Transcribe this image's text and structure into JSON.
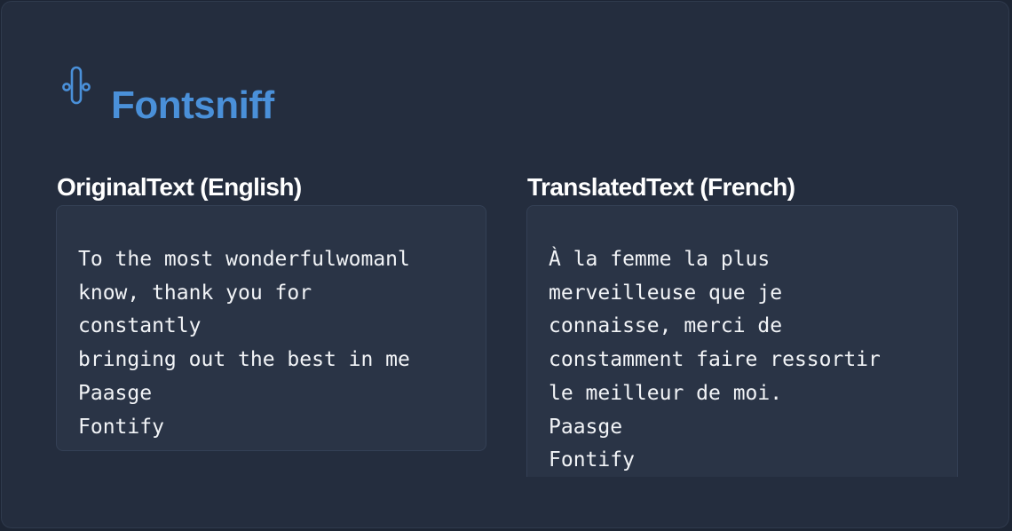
{
  "app": {
    "name": "Fontsniff",
    "logo_icon": "tuning-fork-icon",
    "accent_color": "#4a90d9"
  },
  "original": {
    "title": "OriginalText (English)",
    "text": "To the most wonderfulwomanl\nknow, thank you for\nconstantly\nbringing out the best in me\nPaasge\nFontify"
  },
  "translated": {
    "title": "TranslatedText (French)",
    "text": "À la femme la plus\nmerveilleuse que je\nconnaisse, merci de\nconstamment faire ressortir\nle meilleur de moi.\nPaasge\nFontify"
  }
}
